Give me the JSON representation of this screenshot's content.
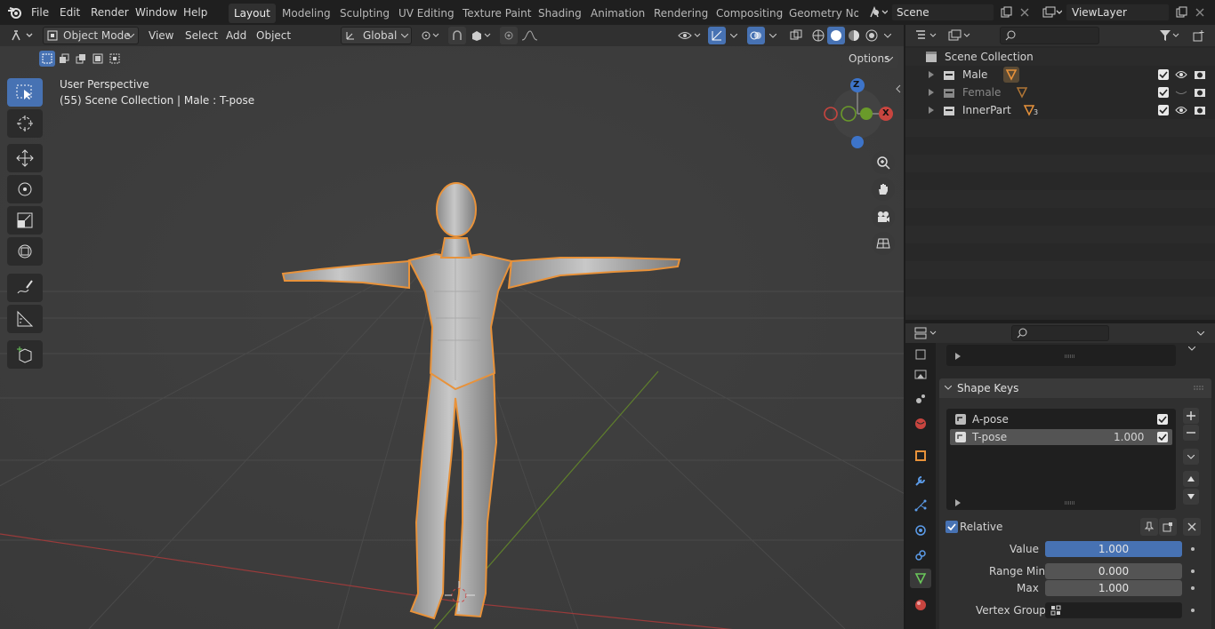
{
  "menubar": {
    "items": [
      "File",
      "Edit",
      "Render",
      "Window",
      "Help"
    ]
  },
  "workspaces": [
    "Layout",
    "Modeling",
    "Sculpting",
    "UV Editing",
    "Texture Paint",
    "Shading",
    "Animation",
    "Rendering",
    "Compositing",
    "Geometry Nod"
  ],
  "scene": {
    "name": "Scene"
  },
  "view_layer": {
    "name": "ViewLayer"
  },
  "viewport_header": {
    "mode": "Object Mode",
    "menus": [
      "View",
      "Select",
      "Add",
      "Object"
    ],
    "orientation": "Global",
    "options_label": "Options"
  },
  "viewport": {
    "perspective_label": "User Perspective",
    "context_label": "(55) Scene Collection | Male : T-pose",
    "gizmo": {
      "z": "Z",
      "x": "X"
    }
  },
  "outliner": {
    "root": "Scene Collection",
    "items": [
      {
        "name": "Male",
        "badge": ""
      },
      {
        "name": "Female",
        "badge": ""
      },
      {
        "name": "InnerPart",
        "badge": "3"
      }
    ]
  },
  "properties": {
    "shape_keys_title": "Shape Keys",
    "keys": [
      {
        "name": "A-pose",
        "value": ""
      },
      {
        "name": "T-pose",
        "value": "1.000"
      }
    ],
    "relative_label": "Relative",
    "value_label": "Value",
    "value": "1.000",
    "value_fraction": 1.0,
    "range_min_label": "Range Min",
    "range_min": "0.000",
    "max_label": "Max",
    "max": "1.000",
    "vertex_group_label": "Vertex Group"
  },
  "colors": {
    "accent": "#4772b3",
    "selection_outline": "#e8923a",
    "axis_x": "#c8453f",
    "axis_y": "#6a9a2a",
    "axis_z": "#3d74c9"
  }
}
